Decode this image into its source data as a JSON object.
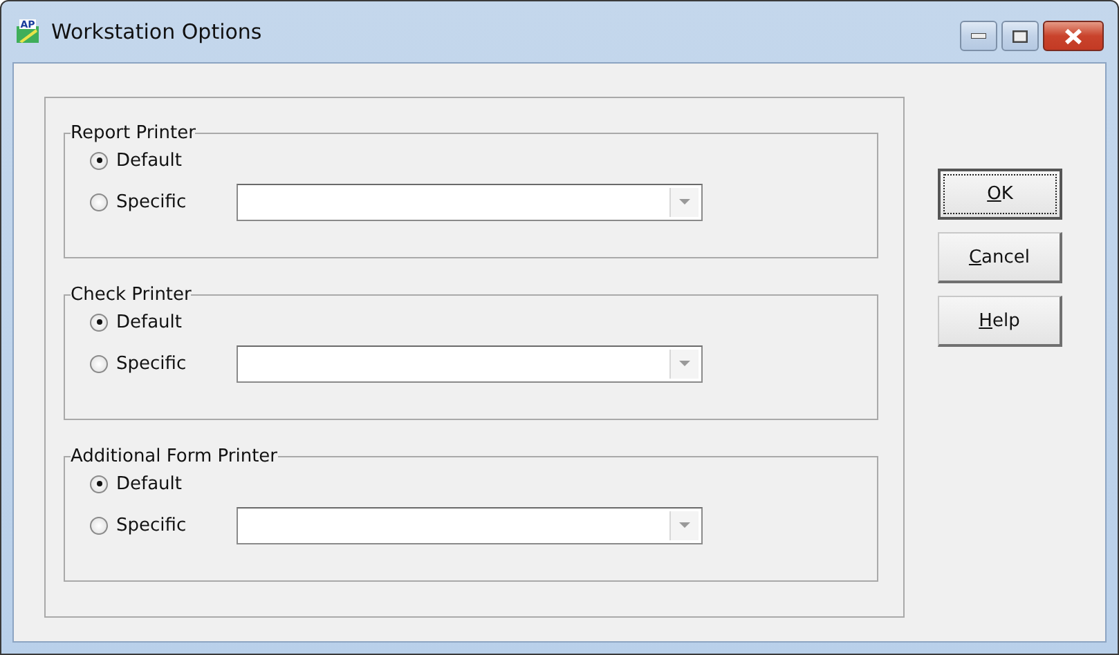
{
  "window": {
    "title": "Workstation Options",
    "icon_text": "AP"
  },
  "groups": [
    {
      "title": "Report Printer",
      "options": [
        {
          "label": "Default",
          "selected": true
        },
        {
          "label": "Specific",
          "selected": false
        }
      ]
    },
    {
      "title": "Check Printer",
      "options": [
        {
          "label": "Default",
          "selected": true
        },
        {
          "label": "Specific",
          "selected": false
        }
      ]
    },
    {
      "title": "Additional Form Printer",
      "options": [
        {
          "label": "Default",
          "selected": true
        },
        {
          "label": "Specific",
          "selected": false
        }
      ]
    }
  ],
  "buttons": [
    {
      "label": "OK",
      "focused": true
    },
    {
      "label": "Cancel",
      "focused": false
    },
    {
      "label": "Help",
      "focused": false
    }
  ]
}
